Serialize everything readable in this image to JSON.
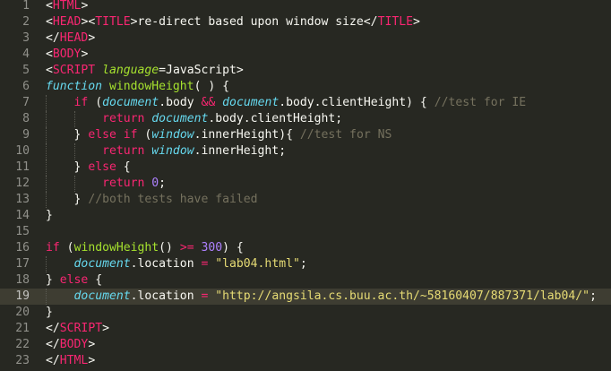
{
  "theme": {
    "background": "#272822",
    "current_line": "#3e3d32",
    "gutter_text": "#90908a",
    "plain": "#f8f8f2",
    "tag": "#f92672",
    "keyword": "#f92672",
    "italic_type": "#66d9ef",
    "function_name": "#a6e22e",
    "string": "#e6db74",
    "number": "#ae81ff",
    "comment": "#75715e",
    "attribute": "#a6e22e"
  },
  "editor": {
    "current_line": 19,
    "lines": [
      {
        "num": "1",
        "tokens": [
          {
            "t": "<",
            "c": "plain"
          },
          {
            "t": "HTML",
            "c": "tag"
          },
          {
            "t": ">",
            "c": "plain"
          }
        ]
      },
      {
        "num": "2",
        "tokens": [
          {
            "t": "<",
            "c": "plain"
          },
          {
            "t": "HEAD",
            "c": "tag"
          },
          {
            "t": "><",
            "c": "plain"
          },
          {
            "t": "TITLE",
            "c": "tag"
          },
          {
            "t": ">re-direct based upon window size</",
            "c": "plain"
          },
          {
            "t": "TITLE",
            "c": "tag"
          },
          {
            "t": ">",
            "c": "plain"
          }
        ]
      },
      {
        "num": "3",
        "tokens": [
          {
            "t": "</",
            "c": "plain"
          },
          {
            "t": "HEAD",
            "c": "tag"
          },
          {
            "t": ">",
            "c": "plain"
          }
        ]
      },
      {
        "num": "4",
        "tokens": [
          {
            "t": "<",
            "c": "plain"
          },
          {
            "t": "BODY",
            "c": "tag"
          },
          {
            "t": ">",
            "c": "plain"
          }
        ]
      },
      {
        "num": "5",
        "tokens": [
          {
            "t": "<",
            "c": "plain"
          },
          {
            "t": "SCRIPT",
            "c": "tag"
          },
          {
            "t": " ",
            "c": "plain"
          },
          {
            "t": "language",
            "c": "attribute"
          },
          {
            "t": "=JavaScript>",
            "c": "plain"
          }
        ]
      },
      {
        "num": "6",
        "tokens": [
          {
            "t": "function",
            "c": "italic_type"
          },
          {
            "t": " ",
            "c": "plain"
          },
          {
            "t": "windowHeight",
            "c": "function_name"
          },
          {
            "t": "( ) {",
            "c": "plain"
          }
        ]
      },
      {
        "num": "7",
        "indent": 1,
        "tokens": [
          {
            "t": "    ",
            "c": "plain"
          },
          {
            "t": "if",
            "c": "keyword"
          },
          {
            "t": " (",
            "c": "plain"
          },
          {
            "t": "document",
            "c": "italic_type"
          },
          {
            "t": ".body ",
            "c": "plain"
          },
          {
            "t": "&&",
            "c": "keyword"
          },
          {
            "t": " ",
            "c": "plain"
          },
          {
            "t": "document",
            "c": "italic_type"
          },
          {
            "t": ".body.clientHeight) { ",
            "c": "plain"
          },
          {
            "t": "//test for IE",
            "c": "comment"
          }
        ]
      },
      {
        "num": "8",
        "indent": 2,
        "tokens": [
          {
            "t": "        ",
            "c": "plain"
          },
          {
            "t": "return",
            "c": "keyword"
          },
          {
            "t": " ",
            "c": "plain"
          },
          {
            "t": "document",
            "c": "italic_type"
          },
          {
            "t": ".body.clientHeight;",
            "c": "plain"
          }
        ]
      },
      {
        "num": "9",
        "indent": 1,
        "tokens": [
          {
            "t": "    } ",
            "c": "plain"
          },
          {
            "t": "else",
            "c": "keyword"
          },
          {
            "t": " ",
            "c": "plain"
          },
          {
            "t": "if",
            "c": "keyword"
          },
          {
            "t": " (",
            "c": "plain"
          },
          {
            "t": "window",
            "c": "italic_type"
          },
          {
            "t": ".innerHeight){ ",
            "c": "plain"
          },
          {
            "t": "//test for NS",
            "c": "comment"
          }
        ]
      },
      {
        "num": "10",
        "indent": 2,
        "tokens": [
          {
            "t": "        ",
            "c": "plain"
          },
          {
            "t": "return",
            "c": "keyword"
          },
          {
            "t": " ",
            "c": "plain"
          },
          {
            "t": "window",
            "c": "italic_type"
          },
          {
            "t": ".innerHeight;",
            "c": "plain"
          }
        ]
      },
      {
        "num": "11",
        "indent": 1,
        "tokens": [
          {
            "t": "    } ",
            "c": "plain"
          },
          {
            "t": "else",
            "c": "keyword"
          },
          {
            "t": " {",
            "c": "plain"
          }
        ]
      },
      {
        "num": "12",
        "indent": 2,
        "tokens": [
          {
            "t": "        ",
            "c": "plain"
          },
          {
            "t": "return",
            "c": "keyword"
          },
          {
            "t": " ",
            "c": "plain"
          },
          {
            "t": "0",
            "c": "number"
          },
          {
            "t": ";",
            "c": "plain"
          }
        ]
      },
      {
        "num": "13",
        "indent": 1,
        "tokens": [
          {
            "t": "    } ",
            "c": "plain"
          },
          {
            "t": "//both tests have failed",
            "c": "comment"
          }
        ]
      },
      {
        "num": "14",
        "tokens": [
          {
            "t": "}",
            "c": "plain"
          }
        ]
      },
      {
        "num": "15",
        "tokens": []
      },
      {
        "num": "16",
        "tokens": [
          {
            "t": "if",
            "c": "keyword"
          },
          {
            "t": " (",
            "c": "plain"
          },
          {
            "t": "windowHeight",
            "c": "function_name"
          },
          {
            "t": "() ",
            "c": "plain"
          },
          {
            "t": ">=",
            "c": "keyword"
          },
          {
            "t": " ",
            "c": "plain"
          },
          {
            "t": "300",
            "c": "number"
          },
          {
            "t": ") {",
            "c": "plain"
          }
        ]
      },
      {
        "num": "17",
        "indent": 1,
        "tokens": [
          {
            "t": "    ",
            "c": "plain"
          },
          {
            "t": "document",
            "c": "italic_type"
          },
          {
            "t": ".location ",
            "c": "plain"
          },
          {
            "t": "=",
            "c": "keyword"
          },
          {
            "t": " ",
            "c": "plain"
          },
          {
            "t": "\"lab04.html\"",
            "c": "string"
          },
          {
            "t": ";",
            "c": "plain"
          }
        ]
      },
      {
        "num": "18",
        "tokens": [
          {
            "t": "} ",
            "c": "plain"
          },
          {
            "t": "else",
            "c": "keyword"
          },
          {
            "t": " {",
            "c": "plain"
          }
        ]
      },
      {
        "num": "19",
        "indent": 1,
        "tokens": [
          {
            "t": "    ",
            "c": "plain"
          },
          {
            "t": "document",
            "c": "italic_type"
          },
          {
            "t": ".location ",
            "c": "plain"
          },
          {
            "t": "=",
            "c": "keyword"
          },
          {
            "t": " ",
            "c": "plain"
          },
          {
            "t": "\"http://angsila.cs.buu.ac.th/~58160407/887371/lab04/\"",
            "c": "string"
          },
          {
            "t": ";",
            "c": "plain"
          }
        ]
      },
      {
        "num": "20",
        "tokens": [
          {
            "t": "}",
            "c": "plain"
          }
        ]
      },
      {
        "num": "21",
        "tokens": [
          {
            "t": "</",
            "c": "plain"
          },
          {
            "t": "SCRIPT",
            "c": "tag"
          },
          {
            "t": ">",
            "c": "plain"
          }
        ]
      },
      {
        "num": "22",
        "tokens": [
          {
            "t": "</",
            "c": "plain"
          },
          {
            "t": "BODY",
            "c": "tag"
          },
          {
            "t": ">",
            "c": "plain"
          }
        ]
      },
      {
        "num": "23",
        "tokens": [
          {
            "t": "</",
            "c": "plain"
          },
          {
            "t": "HTML",
            "c": "tag"
          },
          {
            "t": ">",
            "c": "plain"
          }
        ]
      }
    ]
  }
}
